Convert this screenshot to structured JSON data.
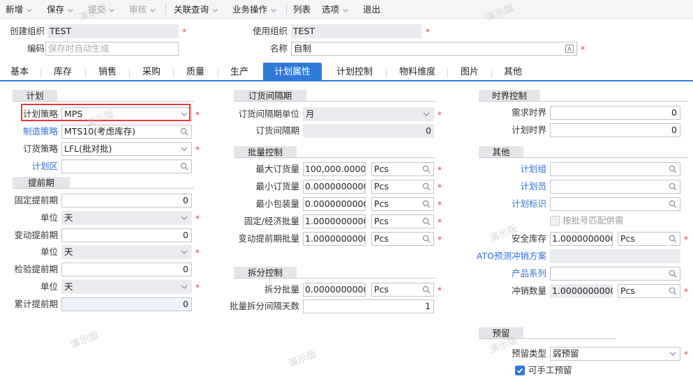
{
  "toolbar": {
    "new": "新增",
    "save": "保存",
    "submit": "提交",
    "audit": "审核",
    "related_query": "关联查询",
    "business_ops": "业务操作",
    "list": "列表",
    "options": "选项",
    "exit": "退出"
  },
  "header": {
    "create_org_label": "创建组织",
    "create_org_value": "TEST",
    "use_org_label": "使用组织",
    "use_org_value": "TEST",
    "code_label": "编码",
    "code_placeholder": "保存时自动生成",
    "name_label": "名称",
    "name_value": "自制"
  },
  "tabs": [
    "基本",
    "库存",
    "销售",
    "采购",
    "质量",
    "生产",
    "计划属性",
    "计划控制",
    "物料维度",
    "图片",
    "其他"
  ],
  "plan": {
    "title": "计划",
    "strategy_label": "计划策略",
    "strategy_value": "MPS",
    "mfg_strategy_label": "制造策略",
    "mfg_strategy_value": "MTS10(考虑库存)",
    "order_strategy_label": "订货策略",
    "order_strategy_value": "LFL(批对批)",
    "plan_zone_label": "计划区",
    "plan_zone_value": ""
  },
  "lead_time": {
    "title": "提前期",
    "fixed_label": "固定提前期",
    "fixed_value": "0",
    "unit_label": "单位",
    "unit_value": "天",
    "variable_label": "变动提前期",
    "variable_value": "0",
    "inspect_label": "检验提前期",
    "inspect_value": "0",
    "cumulative_label": "累计提前期",
    "cumulative_value": "0"
  },
  "order_interval": {
    "title": "订货间隔期",
    "unit_label": "订货间隔期单位",
    "unit_value": "月",
    "period_label": "订货间隔期",
    "period_value": "0"
  },
  "batch": {
    "title": "批量控制",
    "max_label": "最大订货量",
    "max_value": "100,000.00000",
    "min_label": "最小订货量",
    "min_value": "0.0000000000",
    "pack_label": "最小包装量",
    "pack_value": "0.0000000000",
    "eco_label": "固定/经济批量",
    "eco_value": "1.0000000000",
    "var_label": "变动提前期批量",
    "var_value": "1.0000000000",
    "unit_value": "Pcs"
  },
  "split": {
    "title": "拆分控制",
    "batch_label": "拆分批量",
    "batch_value": "0.0000000000",
    "unit_value": "Pcs",
    "interval_label": "批量拆分间隔天数",
    "interval_value": "1"
  },
  "horizon": {
    "title": "时界控制",
    "demand_label": "需求时界",
    "demand_value": "0",
    "plan_label": "计划时界",
    "plan_value": "0"
  },
  "other": {
    "title": "其他",
    "group_label": "计划组",
    "planner_label": "计划员",
    "flag_label": "计划标识",
    "batch_match_label": "按批号匹配供需",
    "safety_label": "安全库存",
    "safety_value": "1.0000000000",
    "safety_unit": "Pcs",
    "ato_label": "ATO预测冲销方案",
    "series_label": "产品系列",
    "offset_label": "冲销数量",
    "offset_value": "1.0000000000",
    "offset_unit": "Pcs"
  },
  "reserve": {
    "title": "预留",
    "type_label": "预留类型",
    "type_value": "弱预留",
    "manual_label": "可手工预留"
  },
  "watermark": "演示版",
  "colors": {
    "accent": "#2f7ad9",
    "required": "#e03c31",
    "highlight": "#e53935",
    "link": "#2e6fd6"
  }
}
